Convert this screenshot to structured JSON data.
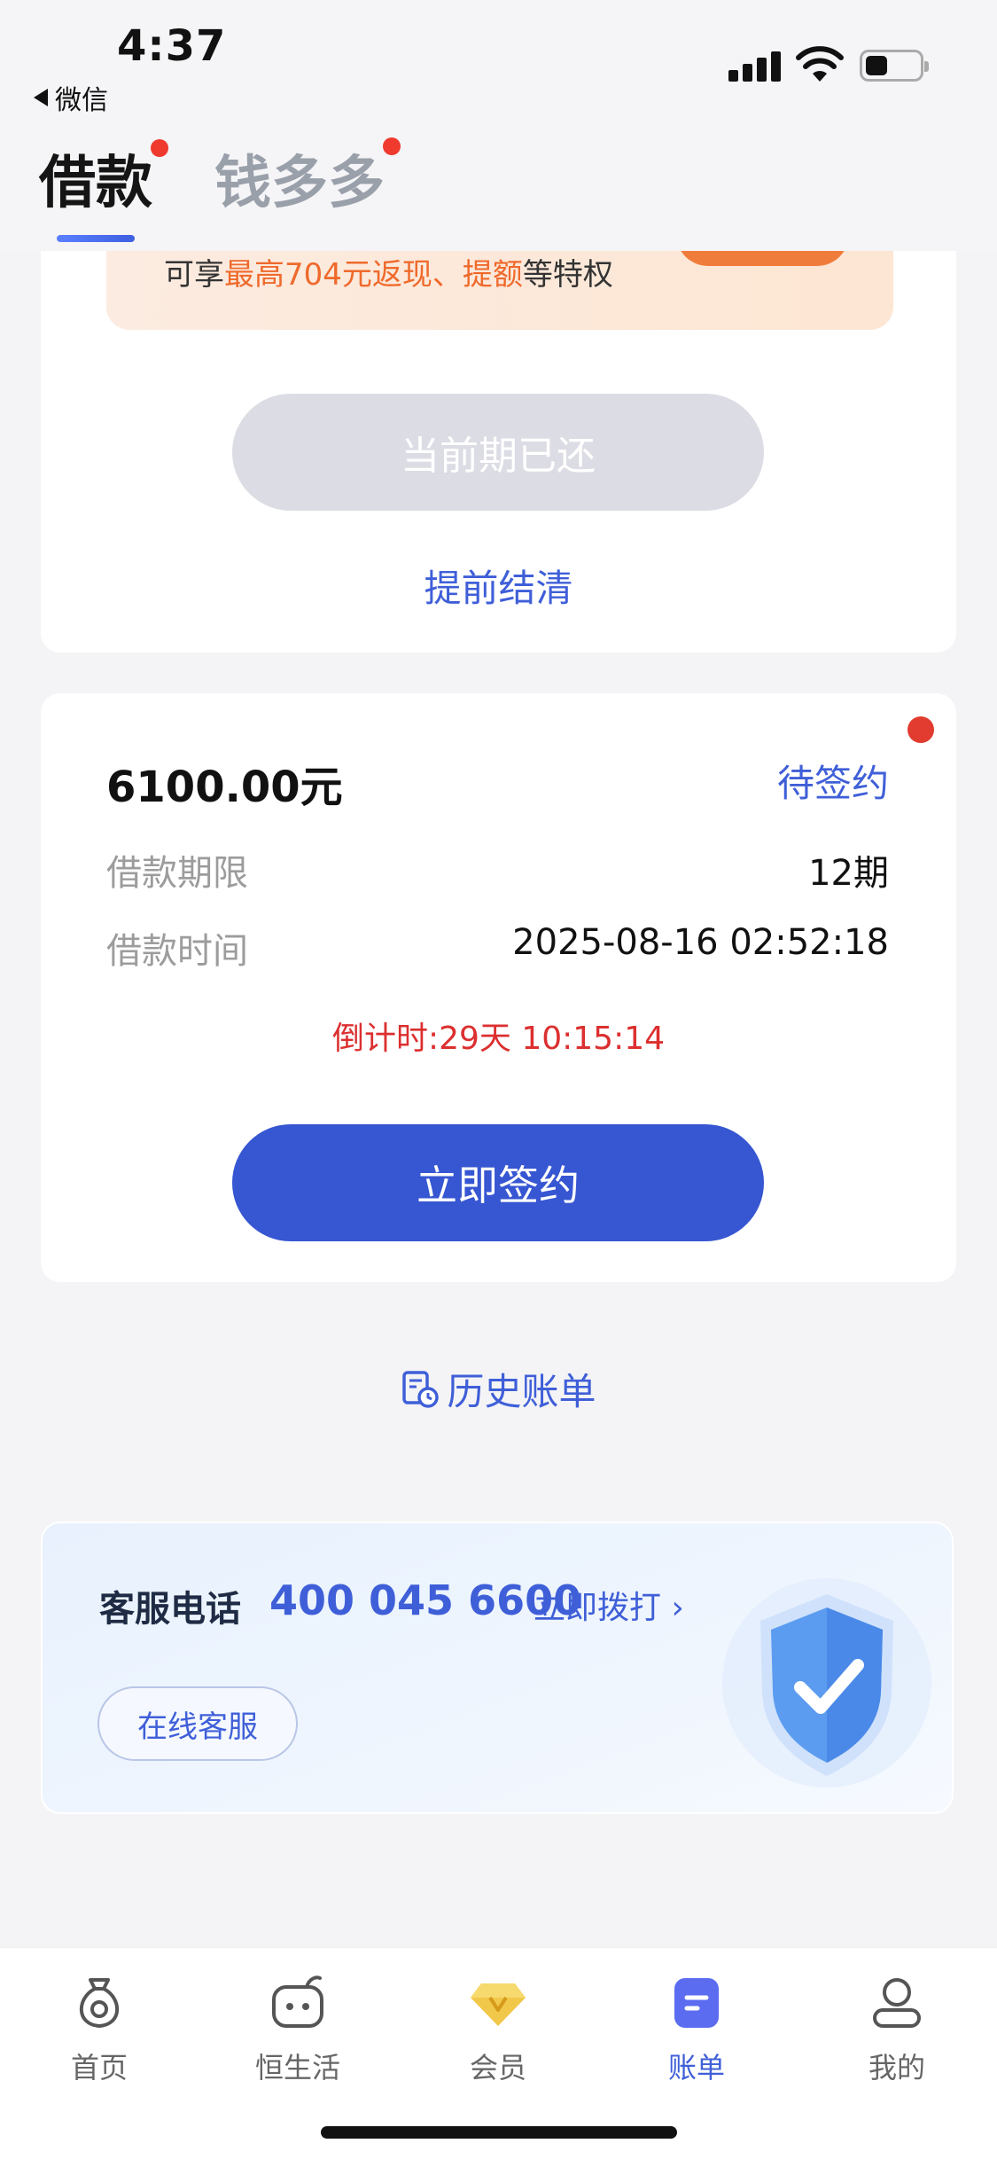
{
  "status_bar": {
    "time": "4:37",
    "back_app": "微信"
  },
  "header": {
    "tabs": [
      {
        "label": "借款"
      },
      {
        "label": "钱多多"
      }
    ]
  },
  "promo": {
    "prefix": "可享",
    "highlight1": "最高704元返现、提额",
    "suffix": "等特权"
  },
  "current_card": {
    "disabled_button": "当前期已还",
    "early_settle": "提前结清"
  },
  "loan_card": {
    "amount": "6100.00元",
    "status": "待签约",
    "term_label": "借款期限",
    "term_value": "12期",
    "time_label": "借款时间",
    "time_value": "2025-08-16 02:52:18",
    "countdown": "倒计时:29天 10:15:14",
    "sign_button": "立即签约"
  },
  "history": {
    "label": "历史账单"
  },
  "service": {
    "label": "客服电话",
    "phone": "400 045 6600",
    "call": "立即拨打 ›",
    "online": "在线客服"
  },
  "bottom_nav": [
    {
      "label": "首页",
      "icon": "money-bag-icon"
    },
    {
      "label": "恒生活",
      "icon": "life-icon"
    },
    {
      "label": "会员",
      "icon": "diamond-icon"
    },
    {
      "label": "账单",
      "icon": "bill-icon"
    },
    {
      "label": "我的",
      "icon": "user-icon"
    }
  ],
  "colors": {
    "accent": "#3656d2",
    "link": "#3f5fd8",
    "alert": "#dc2f2f",
    "promo": "#ef6a2c"
  }
}
